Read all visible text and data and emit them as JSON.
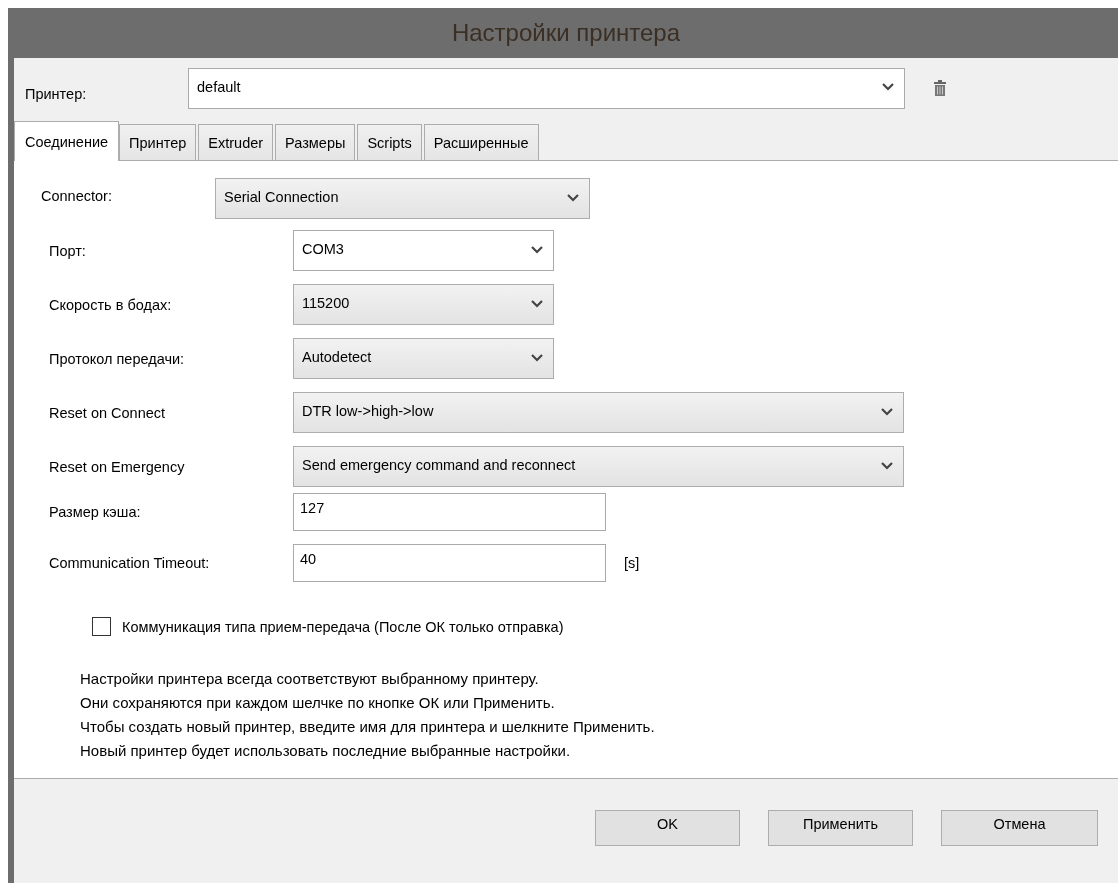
{
  "window": {
    "title": "Настройки принтера"
  },
  "printer": {
    "label": "Принтер:",
    "value": "default"
  },
  "tabs": [
    {
      "label": "Соединение",
      "selected": true
    },
    {
      "label": "Принтер",
      "selected": false
    },
    {
      "label": "Extruder",
      "selected": false
    },
    {
      "label": "Размеры",
      "selected": false
    },
    {
      "label": "Scripts",
      "selected": false
    },
    {
      "label": "Расширенные",
      "selected": false
    }
  ],
  "connector": {
    "label": "Connector:",
    "value": "Serial Connection"
  },
  "settings": [
    {
      "kind": "editable",
      "label": "Порт:",
      "value": "COM3"
    },
    {
      "kind": "list",
      "label": "Скорость в бодах:",
      "value": "115200"
    },
    {
      "kind": "list",
      "label": "Протокол передачи:",
      "value": "Autodetect"
    },
    {
      "kind": "widelist",
      "label": "Reset on Connect",
      "value": "DTR low->high->low"
    },
    {
      "kind": "widelist",
      "label": "Reset on Emergency",
      "value": "Send emergency command and reconnect"
    },
    {
      "kind": "text",
      "label": "Размер кэша:",
      "value": "127"
    },
    {
      "kind": "text",
      "label": "Communication Timeout:",
      "value": "40",
      "unit": "[s]"
    }
  ],
  "ping_pong": {
    "label": "Коммуникация типа прием-передача (После ОК только отправка)",
    "checked": false
  },
  "info": [
    "Настройки принтера всегда соответствуют выбранному принтеру.",
    "Они сохраняются при каждом шелчке по кнопке ОК или Применить.",
    "Чтобы создать новый принтер, введите имя для принтера и шелкните Применить.",
    "Новый принтер будет использовать последние выбранные настройки."
  ],
  "buttons": [
    "OK",
    "Применить",
    "Отмена"
  ]
}
